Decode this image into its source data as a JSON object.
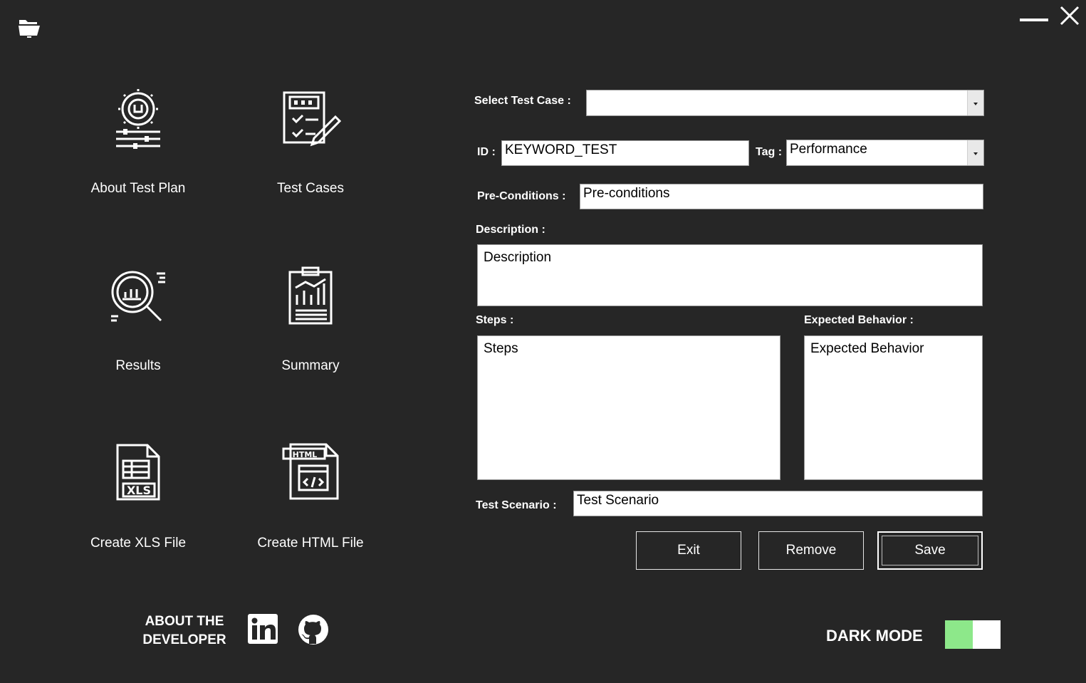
{
  "window": {
    "minimize_icon": "minimize-icon",
    "close_icon": "close-icon",
    "open_folder_icon": "folder-open-icon"
  },
  "nav": {
    "items": [
      {
        "label": "About Test Plan",
        "icon": "gear-settings-icon"
      },
      {
        "label": "Test Cases",
        "icon": "checklist-edit-icon"
      },
      {
        "label": "Results",
        "icon": "magnifier-chart-icon"
      },
      {
        "label": "Summary",
        "icon": "clipboard-chart-icon"
      },
      {
        "label": "Create XLS File",
        "icon": "xls-file-icon"
      },
      {
        "label": "Create HTML File",
        "icon": "html-file-icon"
      }
    ]
  },
  "form": {
    "select_test_case_label": "Select Test Case :",
    "select_test_case_value": "",
    "id_label": "ID :",
    "id_value": "KEYWORD_TEST",
    "tag_label": "Tag :",
    "tag_value": "Performance",
    "preconditions_label": "Pre-Conditions :",
    "preconditions_value": "Pre-conditions",
    "description_label": "Description :",
    "description_value": "Description",
    "steps_label": "Steps :",
    "steps_value": "Steps",
    "expected_label": "Expected Behavior :",
    "expected_value": "Expected Behavior",
    "scenario_label": "Test Scenario :",
    "scenario_value": "Test Scenario"
  },
  "buttons": {
    "exit": "Exit",
    "remove": "Remove",
    "save": "Save"
  },
  "footer": {
    "about_line1": "ABOUT THE",
    "about_line2": "DEVELOPER",
    "linkedin_icon": "linkedin-icon",
    "github_icon": "github-icon",
    "dark_mode_label": "DARK MODE",
    "dark_mode_on": true
  },
  "colors": {
    "background": "#262626",
    "text": "#ffffff",
    "toggle_on": "#8de88a"
  }
}
